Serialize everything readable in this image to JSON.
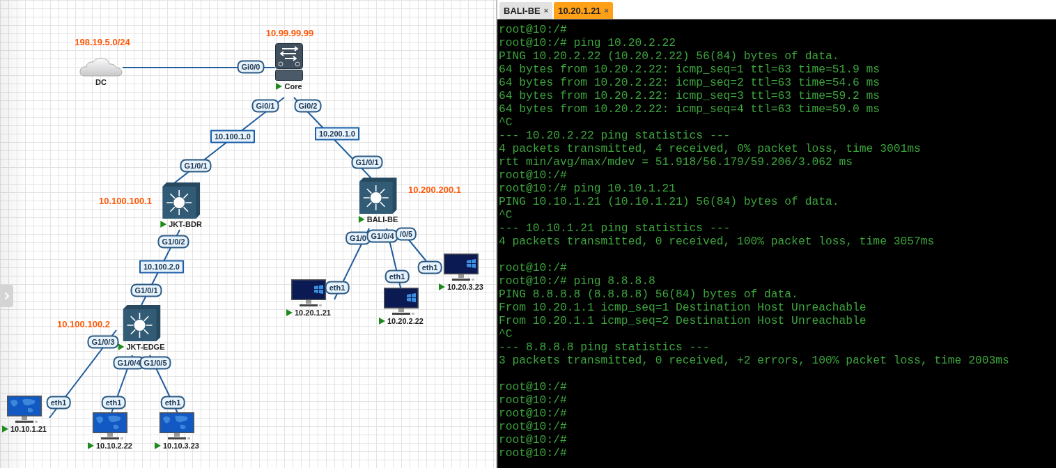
{
  "topology": {
    "nodes": [
      {
        "kind": "cloud",
        "name": "DC",
        "ip": "198.19.5.0/24"
      },
      {
        "kind": "router",
        "name": "Core",
        "ip": "10.99.99.99",
        "running": true
      },
      {
        "kind": "switch",
        "name": "JKT-BDR",
        "ip": "10.100.100.1",
        "running": true
      },
      {
        "kind": "switch",
        "name": "BALI-BE",
        "ip": "10.200.200.1",
        "running": true
      },
      {
        "kind": "switch",
        "name": "JKT-EDGE",
        "ip": "10.100.100.2",
        "running": true
      },
      {
        "kind": "pc_linux",
        "name": "10.10.1.21",
        "running": true
      },
      {
        "kind": "pc_linux",
        "name": "10.10.2.22",
        "running": true
      },
      {
        "kind": "pc_linux",
        "name": "10.10.3.23",
        "running": true
      },
      {
        "kind": "pc_windows",
        "name": "10.20.1.21",
        "running": true
      },
      {
        "kind": "pc_windows",
        "name": "10.20.2.22",
        "running": true
      },
      {
        "kind": "pc_windows",
        "name": "10.20.3.23",
        "running": true
      }
    ],
    "links": [
      {
        "labels": [
          {
            "kind": "port",
            "text": "Gi0/0"
          }
        ]
      },
      {
        "labels": [
          {
            "kind": "port",
            "text": "Gi0/1"
          },
          {
            "kind": "subnet",
            "text": "10.100.1.0"
          },
          {
            "kind": "port",
            "text": "G1/0/1"
          }
        ]
      },
      {
        "labels": [
          {
            "kind": "port",
            "text": "Gi0/2"
          },
          {
            "kind": "subnet",
            "text": "10.200.1.0"
          },
          {
            "kind": "port",
            "text": "G1/0/1"
          }
        ]
      },
      {
        "labels": [
          {
            "kind": "port",
            "text": "G1/0/2"
          },
          {
            "kind": "subnet",
            "text": "10.100.2.0"
          },
          {
            "kind": "port",
            "text": "G1/0/1"
          }
        ]
      },
      {
        "labels": [
          {
            "kind": "port",
            "text": "G1/0/3"
          },
          {
            "kind": "port",
            "text": "eth1"
          }
        ]
      },
      {
        "labels": [
          {
            "kind": "port",
            "text": "G1/0/4"
          },
          {
            "kind": "port",
            "text": "eth1"
          }
        ]
      },
      {
        "labels": [
          {
            "kind": "port",
            "text": "G1/0/5"
          },
          {
            "kind": "port",
            "text": "eth1"
          }
        ]
      },
      {
        "labels": [
          {
            "kind": "port",
            "text": "G1/0"
          },
          {
            "kind": "port",
            "text": "eth1"
          }
        ]
      },
      {
        "labels": [
          {
            "kind": "port",
            "text": "G1/0/4"
          },
          {
            "kind": "port",
            "text": "eth1"
          }
        ]
      },
      {
        "labels": [
          {
            "kind": "port",
            "text": "/0/5"
          },
          {
            "kind": "port",
            "text": "eth1"
          }
        ]
      }
    ]
  },
  "console": {
    "tabs": [
      {
        "label": "BALI-BE",
        "close": "×",
        "selected": false
      },
      {
        "label": "10.20.1.21",
        "close": "×",
        "selected": true
      }
    ],
    "blocks": [
      [
        "root@10:/#",
        "root@10:/# ping 10.20.2.22",
        "PING 10.20.2.22 (10.20.2.22) 56(84) bytes of data.",
        "64 bytes from 10.20.2.22: icmp_seq=1 ttl=63 time=51.9 ms",
        "64 bytes from 10.20.2.22: icmp_seq=2 ttl=63 time=54.6 ms",
        "64 bytes from 10.20.2.22: icmp_seq=3 ttl=63 time=59.2 ms",
        "64 bytes from 10.20.2.22: icmp_seq=4 ttl=63 time=59.0 ms",
        "^C",
        "--- 10.20.2.22 ping statistics ---",
        "4 packets transmitted, 4 received, 0% packet loss, time 3001ms",
        "rtt min/avg/max/mdev = 51.918/56.179/59.206/3.062 ms",
        "root@10:/#",
        "root@10:/# ping 10.10.1.21",
        "PING 10.10.1.21 (10.10.1.21) 56(84) bytes of data.",
        "^C",
        "--- 10.10.1.21 ping statistics ---",
        "4 packets transmitted, 0 received, 100% packet loss, time 3057ms"
      ],
      [
        "root@10:/#",
        "root@10:/# ping 8.8.8.8",
        "PING 8.8.8.8 (8.8.8.8) 56(84) bytes of data.",
        "From 10.20.1.1 icmp_seq=1 Destination Host Unreachable",
        "From 10.20.1.1 icmp_seq=2 Destination Host Unreachable",
        "^C",
        "--- 8.8.8.8 ping statistics ---",
        "3 packets transmitted, 0 received, +2 errors, 100% packet loss, time 2003ms"
      ],
      [
        "root@10:/#",
        "root@10:/#",
        "root@10:/#",
        "root@10:/#",
        "root@10:/#",
        "root@10:/#"
      ]
    ]
  }
}
